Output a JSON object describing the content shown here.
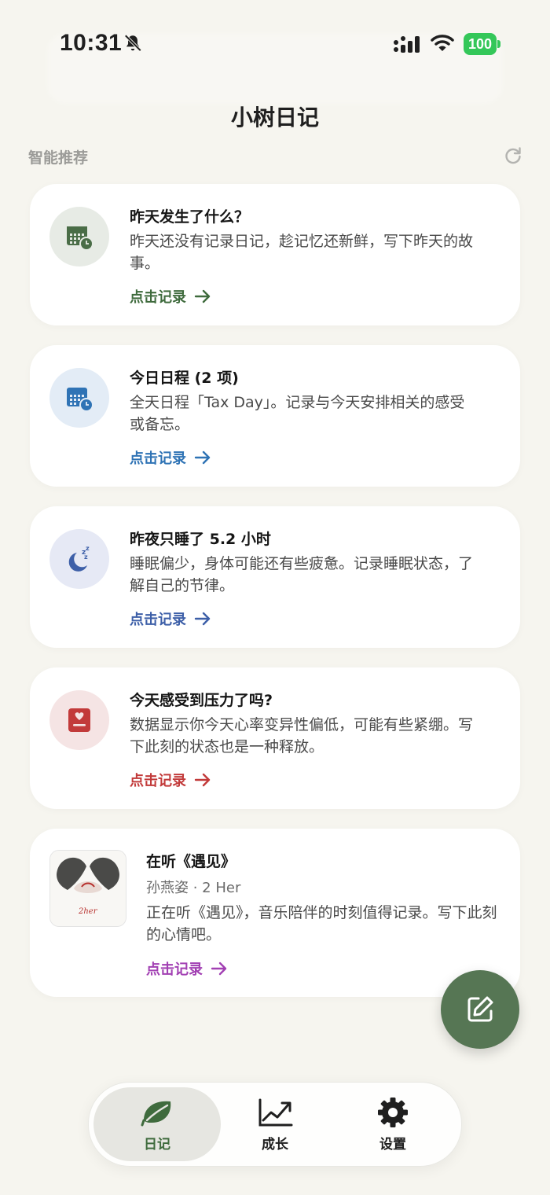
{
  "status_bar": {
    "time": "10:31",
    "battery": "100"
  },
  "header": {
    "title": "小树日记"
  },
  "section": {
    "label": "智能推荐"
  },
  "cards": [
    {
      "title": "昨天发生了什么？",
      "desc": "昨天还没有记录日记，趁记忆还新鲜，写下昨天的故事。",
      "link": "点击记录",
      "color": "#3f6b3d",
      "bg": "#e7ebe5",
      "icon": "calendar-clock-icon"
    },
    {
      "title": "今日日程 (2 项)",
      "desc": "全天日程「Tax Day」。记录与今天安排相关的感受或备忘。",
      "link": "点击记录",
      "color": "#2f73b5",
      "bg": "#e3ecf6",
      "icon": "calendar-clock-icon"
    },
    {
      "title": "昨夜只睡了 5.2 小时",
      "desc": "睡眠偏少，身体可能还有些疲惫。记录睡眠状态，了解自己的节律。",
      "link": "点击记录",
      "color": "#3d5fa8",
      "bg": "#e6e9f5",
      "icon": "moon-zzz-icon"
    },
    {
      "title": "今天感受到压力了吗?",
      "desc": "数据显示你今天心率变异性偏低，可能有些紧绷。写下此刻的状态也是一种释放。",
      "link": "点击记录",
      "color": "#c23a3a",
      "bg": "#f5e4e4",
      "icon": "heart-report-icon"
    }
  ],
  "music": {
    "title": "在听《遇见》",
    "artist": "孙燕姿 · 2 Her",
    "desc": "正在听《遇见》，音乐陪伴的时刻值得记录。写下此刻的心情吧。",
    "link": "点击记录",
    "color": "#a240b3"
  },
  "tabs": [
    {
      "label": "日记",
      "icon": "leaf-icon",
      "active": true
    },
    {
      "label": "成长",
      "icon": "growth-chart-icon",
      "active": false
    },
    {
      "label": "设置",
      "icon": "gear-icon",
      "active": false
    }
  ]
}
